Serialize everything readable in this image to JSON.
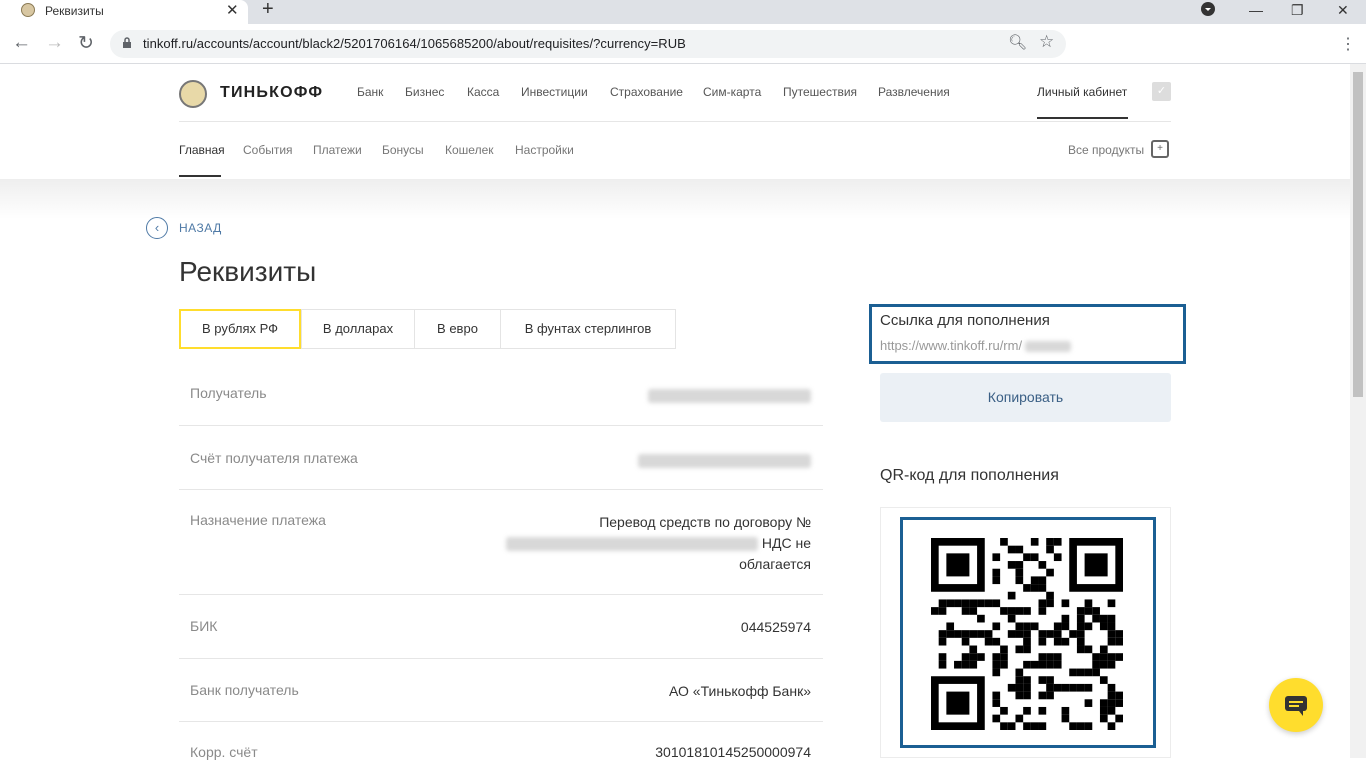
{
  "browser": {
    "tab_title": "Реквизиты",
    "url": "tinkoff.ru/accounts/account/black2/5201706164/1065685200/about/requisites/?currency=RUB"
  },
  "header": {
    "logo_text": "ТИНЬКОФФ",
    "nav": [
      "Банк",
      "Бизнес",
      "Касса",
      "Инвестиции",
      "Страхование",
      "Сим-карта",
      "Путешествия",
      "Развлечения"
    ],
    "cabinet": "Личный кабинет",
    "subnav": [
      "Главная",
      "События",
      "Платежи",
      "Бонусы",
      "Кошелек",
      "Настройки"
    ],
    "all_products": "Все продукты"
  },
  "back_label": "НАЗАД",
  "title": "Реквизиты",
  "currency_tabs": [
    "В рублях РФ",
    "В долларах",
    "В евро",
    "В фунтах стерлингов"
  ],
  "rows": [
    {
      "label": "Получатель",
      "value": ""
    },
    {
      "label": "Счёт получателя платежа",
      "value": ""
    },
    {
      "label": "Назначение платежа",
      "value_line1": "Перевод средств по договору №",
      "value_line2": "НДС не",
      "value_line3": "облагается"
    },
    {
      "label": "БИК",
      "value": "044525974"
    },
    {
      "label": "Банк получатель",
      "value": "АО «Тинькофф Банк»"
    },
    {
      "label": "Корр. счёт",
      "value": "30101810145250000974"
    }
  ],
  "replenish": {
    "link_title": "Ссылка для пополнения",
    "link_url": "https://www.tinkoff.ru/rm/",
    "copy_button": "Копировать",
    "qr_title": "QR-код для пополнения"
  },
  "colors": {
    "brand_yellow": "#ffdd2d",
    "highlight_blue": "#1b5f93",
    "link_blue": "#4f7aa6"
  }
}
